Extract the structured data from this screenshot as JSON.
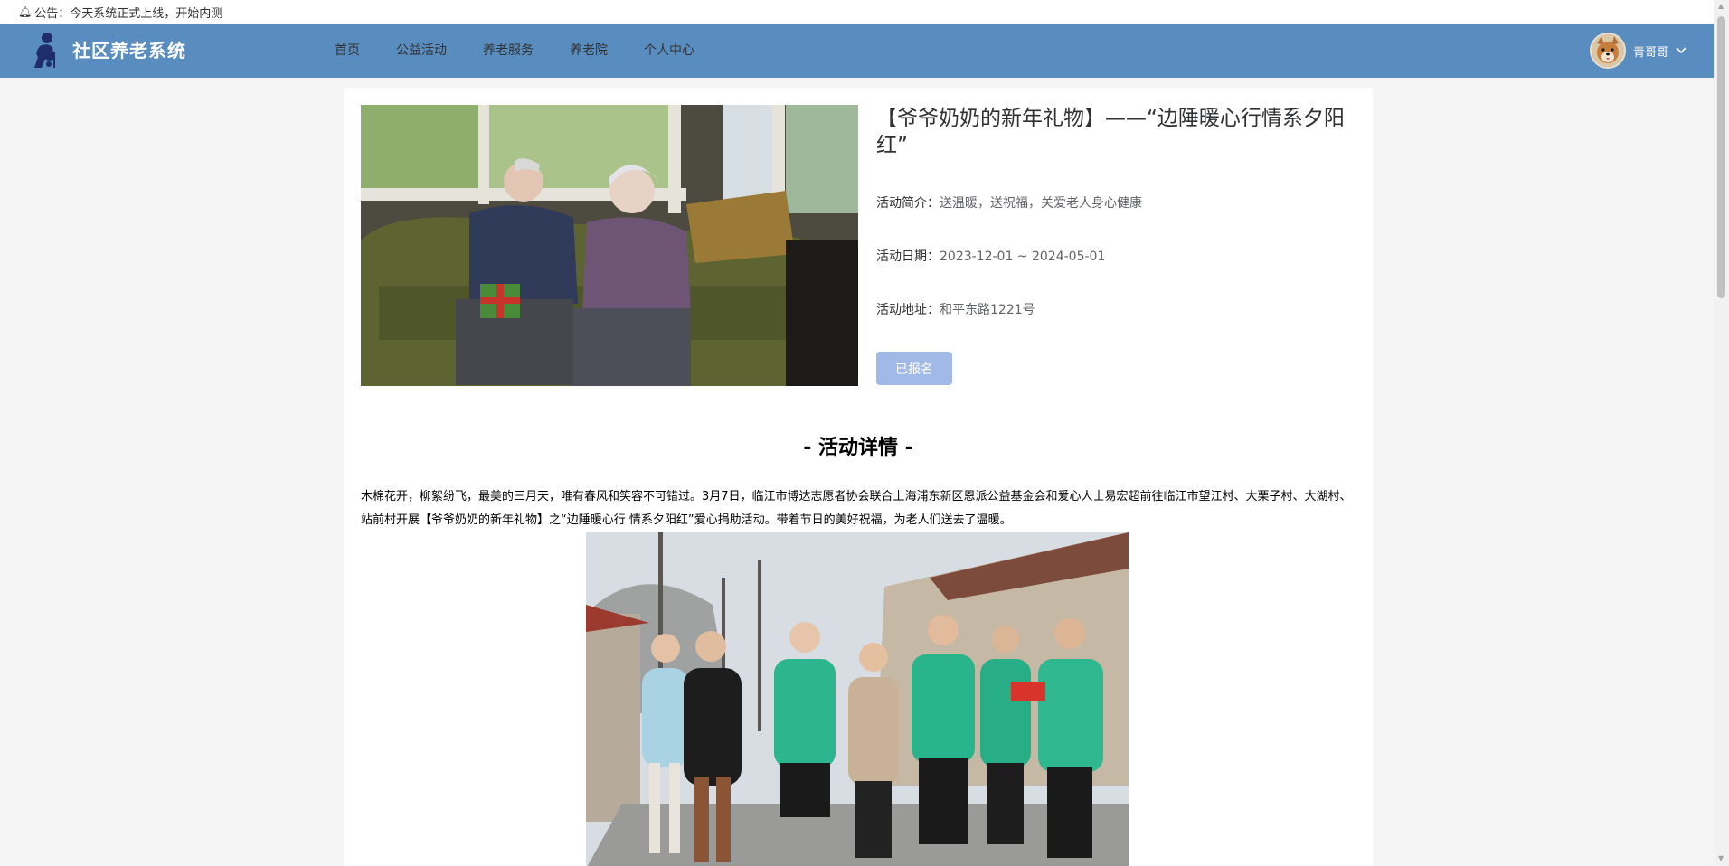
{
  "announcement": {
    "icon": "bell-icon",
    "text": "公告：今天系统正式上线，开始内测"
  },
  "header": {
    "brand": "社区养老系统",
    "logo": "elderly-person-logo",
    "nav": [
      {
        "label": "首页"
      },
      {
        "label": "公益活动"
      },
      {
        "label": "养老服务"
      },
      {
        "label": "养老院"
      },
      {
        "label": "个人中心"
      }
    ],
    "user": {
      "name": "青哥哥",
      "avatar": "dog-avatar",
      "dropdown_icon": "chevron-down-icon"
    }
  },
  "activity": {
    "cover_image": "elderly-couple-gift-photo",
    "title": "【爷爷奶奶的新年礼物】——“边陲暖心行情系夕阳红”",
    "intro_label": "活动简介：",
    "intro": "送温暖，送祝福，关爱老人身心健康",
    "date_label": "活动日期：",
    "date": "2023-12-01 ~ 2024-05-01",
    "address_label": "活动地址：",
    "address": "和平东路1221号",
    "signup_button": "已报名",
    "detail_heading": "- 活动详情 -",
    "detail_text": "木棉花开，柳絮纷飞，最美的三月天，唯有春风和笑容不可错过。3月7日，临江市博达志愿者协会联合上海浦东新区恩派公益基金会和爱心人士易宏超前往临江市望江村、大栗子村、大湖村、站前村开展【爷爷奶奶的新年礼物】之“边陲暖心行 情系夕阳红”爱心捐助活动。带着节日的美好祝福，为老人们送去了温暖。",
    "detail_image": "volunteers-group-photo"
  },
  "colors": {
    "header_bg": "#5a8dbf",
    "signed_button_bg": "#a0b9e6",
    "page_bg": "#f5f5f5"
  }
}
